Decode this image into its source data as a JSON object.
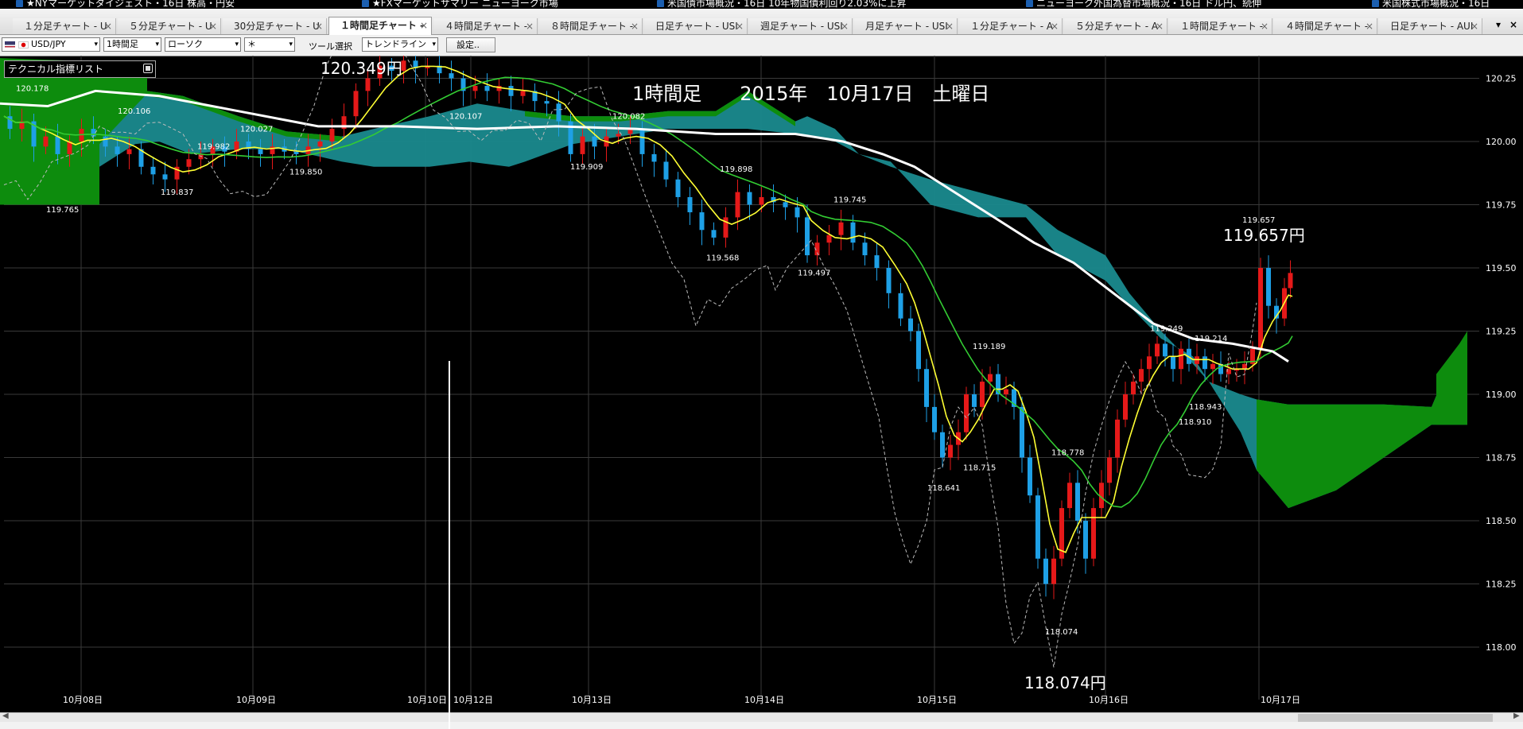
{
  "ticker": [
    "★NYマーケットダイジェスト・16日 株高・円安",
    "★FXマーケットサマリー ニューヨーク市場",
    "米国債市場概況・16日 10年物国債利回り2.03%に上昇",
    "ニューヨーク外国為替市場概況・16日 ドル円、続伸",
    "米国株式市場概況・16日"
  ],
  "tabs": [
    {
      "label": "１分足チャート - U",
      "active": false
    },
    {
      "label": "５分足チャート - U",
      "active": false
    },
    {
      "label": "30分足チャート - U",
      "active": false
    },
    {
      "label": "１時間足チャート -",
      "active": true
    },
    {
      "label": "４時間足チャート -",
      "active": false
    },
    {
      "label": "８時間足チャート -",
      "active": false
    },
    {
      "label": "日足チャート - USI",
      "active": false
    },
    {
      "label": "週足チャート - USI",
      "active": false
    },
    {
      "label": "月足チャート - USI",
      "active": false
    },
    {
      "label": "１分足チャート - A",
      "active": false
    },
    {
      "label": "５分足チャート - A",
      "active": false
    },
    {
      "label": "１時間足チャート -",
      "active": false
    },
    {
      "label": "４時間足チャート -",
      "active": false
    },
    {
      "label": "日足チャート - AUI",
      "active": false
    }
  ],
  "tab_close": "×",
  "tab_menu": "▾",
  "tab_close_all": "×",
  "toolbar": {
    "pair": "USD/JPY",
    "timeframe": "1時間足",
    "chart_type": "ローソク",
    "extra": "＊",
    "tool_label": "ツール選択",
    "tool": "トレンドライン",
    "settings": "設定..",
    "dropdown": "▾"
  },
  "panel": {
    "title": "テクニカル指標リスト"
  },
  "chart_title": "1時間足　　2015年　10月17日　土曜日",
  "big_prices": {
    "high": "120.349円",
    "recent_high": "119.657円",
    "low": "118.074円"
  },
  "chart_data": {
    "type": "candlestick",
    "timeframe": "1時間足",
    "y_ticks": [
      "120.25",
      "120.00",
      "119.75",
      "119.50",
      "119.25",
      "119.00",
      "118.75",
      "118.50",
      "118.25",
      "118.00"
    ],
    "ylim": [
      117.98,
      120.45
    ],
    "x_ticks": [
      "10月08日",
      "10月09日",
      "10月10日",
      "10月12日",
      "10月13日",
      "10月14日",
      "10月15日",
      "10月16日",
      "10月17日"
    ],
    "point_labels": [
      "120.178",
      "120.106",
      "119.765",
      "119.982",
      "119.837",
      "120.027",
      "119.850",
      "120.349",
      "120.107",
      "119.909",
      "120.082",
      "119.898",
      "119.568",
      "119.745",
      "119.497",
      "118.641",
      "118.715",
      "119.189",
      "118.778",
      "118.074",
      "119.249",
      "119.214",
      "118.910",
      "118.943",
      "119.657"
    ],
    "colors": {
      "background": "#000000",
      "bull": "#e51919",
      "bear": "#1ea0e6",
      "kumo_bull": "#0d8c0d",
      "kumo_bear": "#1a8a8e",
      "ma_short": "#ffff33",
      "ma_mid": "#33cc33",
      "ma_long": "#ffffff",
      "grid": "#3a3a3a"
    }
  }
}
